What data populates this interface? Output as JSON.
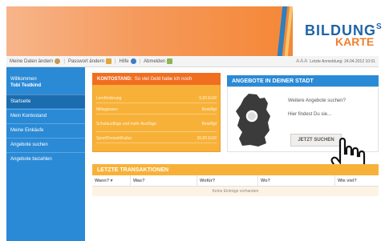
{
  "logo": {
    "line1_main": "BILDUNG",
    "line1_small": "S",
    "line2": "KARTE"
  },
  "topnav": {
    "items": [
      {
        "label": "Meine Daten ändern",
        "icon": "person-icon"
      },
      {
        "label": "Passwort ändern",
        "icon": "house-icon"
      },
      {
        "label": "Hilfe",
        "icon": "help-icon"
      },
      {
        "label": "Abmelden",
        "icon": "exit-icon"
      }
    ],
    "font_size_controls": "A A A",
    "last_login": "Letzte Anmeldung: 24.04.2012 10:01"
  },
  "sidebar": {
    "welcome": "Willkommen",
    "user_name": "Tobi Testkind",
    "items": [
      {
        "label": "Startseite",
        "active": true
      },
      {
        "label": "Mein Kontostand",
        "active": false
      },
      {
        "label": "Meine Einkäufe",
        "active": false
      },
      {
        "label": "Angebote suchen",
        "active": false
      },
      {
        "label": "Angebote bezahlen",
        "active": false
      }
    ]
  },
  "konto": {
    "title": "KONTOSTAND:",
    "subtitle": "So viel Geld habe ich noch",
    "rows": [
      {
        "label": "Lernförderung",
        "value": "0,00 EUR"
      },
      {
        "label": "Mittagessen",
        "value": "Bewilligt"
      },
      {
        "label": "Schulausflüge und mehr-Ausflüge",
        "value": "Bewilligt"
      },
      {
        "label": "Sport/Freizeit/Kultur",
        "value": "30,00 EUR"
      }
    ]
  },
  "angebote": {
    "title": "ANGEBOTE IN DEINER STADT",
    "text1": "Weitere Angebote suchen?",
    "text2": "Hier findest Du sie...",
    "button": "JETZT SUCHEN"
  },
  "transaktionen": {
    "title": "LETZTE TRANSAKTIONEN",
    "columns": [
      "Wann? ▾",
      "Was?",
      "Wofür?",
      "Wo?",
      "Wie viel?"
    ],
    "empty": "Keine Einträge vorhanden"
  },
  "colors": {
    "header_orange": "#f58a3c",
    "sidebar_blue": "#2a8ad6",
    "konto_yellow": "#f8b138",
    "konto_header": "#f06e20"
  }
}
